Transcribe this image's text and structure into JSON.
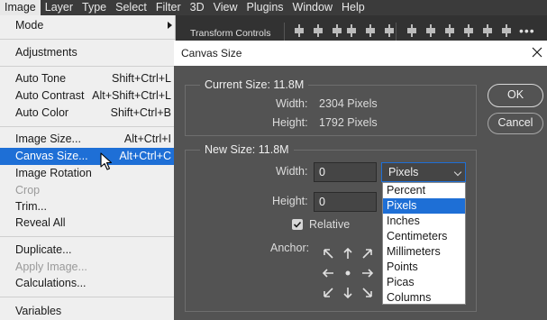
{
  "menubar": {
    "items": [
      "Image",
      "Layer",
      "Type",
      "Select",
      "Filter",
      "3D",
      "View",
      "Plugins",
      "Window",
      "Help"
    ]
  },
  "optionsbar": {
    "transform_controls": "Transform Controls"
  },
  "image_menu": {
    "items": [
      {
        "label": "Mode",
        "shortcut": "",
        "submenu": true
      },
      {
        "label": "Adjustments",
        "shortcut": ""
      },
      {
        "label": "Auto Tone",
        "shortcut": "Shift+Ctrl+L"
      },
      {
        "label": "Auto Contrast",
        "shortcut": "Alt+Shift+Ctrl+L"
      },
      {
        "label": "Auto Color",
        "shortcut": "Shift+Ctrl+B"
      },
      {
        "label": "Image Size...",
        "shortcut": "Alt+Ctrl+I"
      },
      {
        "label": "Canvas Size...",
        "shortcut": "Alt+Ctrl+C",
        "highlighted": true
      },
      {
        "label": "Image Rotation",
        "shortcut": ""
      },
      {
        "label": "Crop",
        "shortcut": "",
        "disabled": true
      },
      {
        "label": "Trim...",
        "shortcut": ""
      },
      {
        "label": "Reveal All",
        "shortcut": ""
      },
      {
        "label": "Duplicate...",
        "shortcut": ""
      },
      {
        "label": "Apply Image...",
        "shortcut": "",
        "disabled": true
      },
      {
        "label": "Calculations...",
        "shortcut": ""
      },
      {
        "label": "Variables",
        "shortcut": ""
      }
    ]
  },
  "dialog": {
    "title": "Canvas Size",
    "current_size": {
      "legend": "Current Size: 11.8M",
      "width_label": "Width:",
      "width_value": "2304 Pixels",
      "height_label": "Height:",
      "height_value": "1792 Pixels"
    },
    "new_size": {
      "legend": "New Size: 11.8M",
      "width_label": "Width:",
      "width_value": "0",
      "height_label": "Height:",
      "height_value": "0",
      "unit_selected": "Pixels",
      "relative_label": "Relative",
      "relative_checked": true,
      "anchor_label": "Anchor:"
    },
    "ok_label": "OK",
    "cancel_label": "Cancel",
    "unit_options": [
      "Percent",
      "Pixels",
      "Inches",
      "Centimeters",
      "Millimeters",
      "Points",
      "Picas",
      "Columns"
    ]
  },
  "colors": {
    "accent": "#1e6fd6",
    "dialog_bg": "#535353",
    "menubar_bg": "#3b3b3b"
  }
}
